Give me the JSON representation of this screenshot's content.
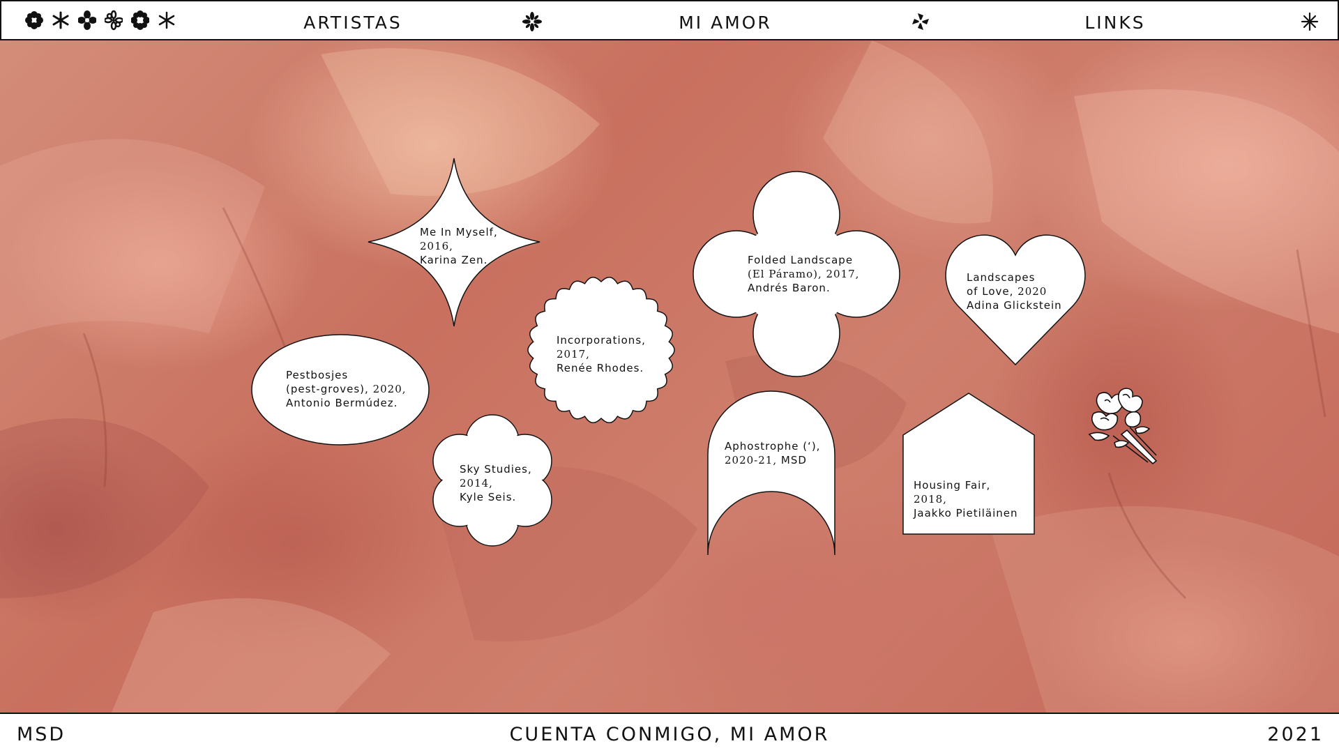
{
  "nav": {
    "artists": "ARTISTAS",
    "love": "MI AMOR",
    "links": "LINKS"
  },
  "works": [
    {
      "title": "Me In Myself,",
      "year": "2016,",
      "artist": "Karina Zen."
    },
    {
      "title": "Pestbosjes",
      "subtitle": "(pest-groves),",
      "year": "2020,",
      "artist": "Antonio Bermúdez."
    },
    {
      "title": "Incorporations,",
      "year": "2017,",
      "artist": "Renée Rhodes."
    },
    {
      "title": "Sky Studies,",
      "year": "2014,",
      "artist": "Kyle Seis."
    },
    {
      "title": "Folded Landscape",
      "subtitle": "(El Páramo),",
      "year": "2017,",
      "artist": "Andrés Baron."
    },
    {
      "title": "Aphostrophe (‘),",
      "year": "2020-21,",
      "artist": "MSD"
    },
    {
      "title": "Landscapes",
      "title2": "of Love,",
      "year": "2020",
      "artist": "Adina Glickstein"
    },
    {
      "title": "Housing Fair,",
      "year": "2018,",
      "artist": "Jaakko Pietiläinen"
    }
  ],
  "footer": {
    "left": "MSD",
    "center": "CUENTA CONMIGO, MI AMOR",
    "right": "2021"
  },
  "icons": [
    "flower-1-icon",
    "asterisk-flower-icon",
    "flower-2-icon",
    "flower-3-icon",
    "flower-4-icon",
    "asterisk-icon",
    "star-flower-icon",
    "bouquet-icon"
  ],
  "colors": {
    "bar_background": "#ffffff",
    "petal_background": "#c9705f",
    "ink": "#111111"
  }
}
